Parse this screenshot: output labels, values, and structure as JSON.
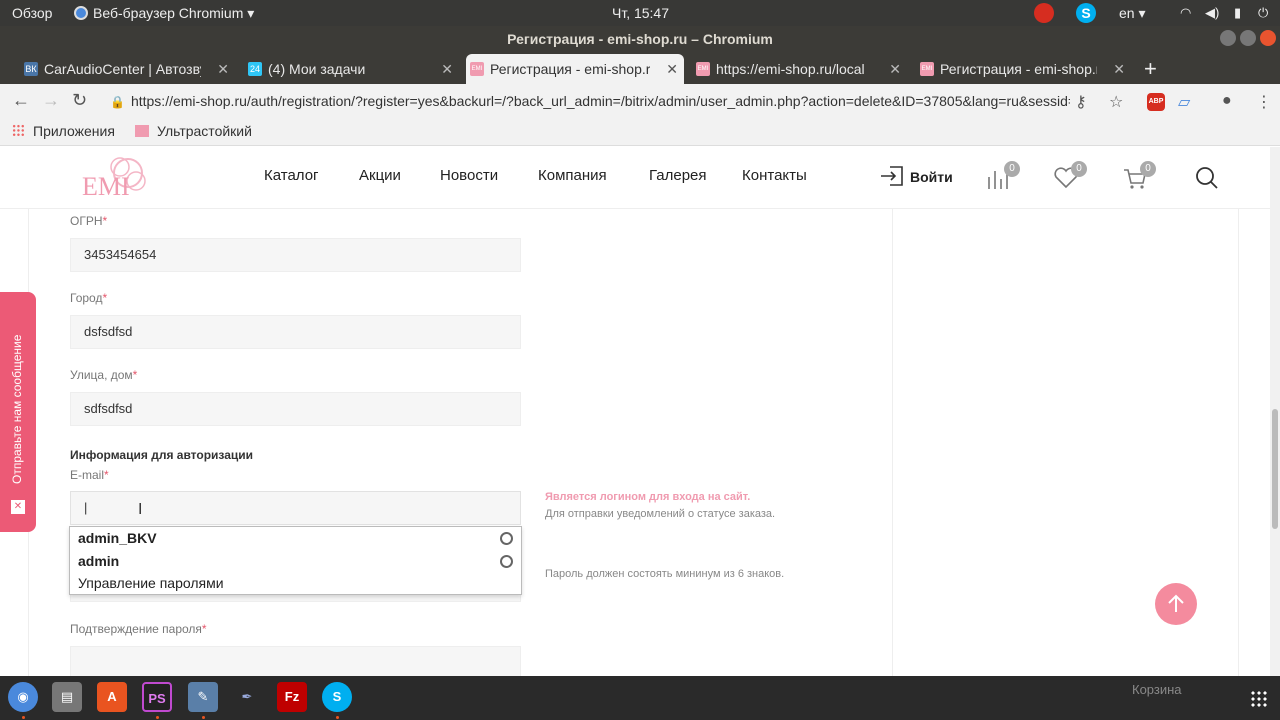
{
  "os": {
    "activities": "Обзор",
    "app_menu": "Веб-браузер Chromium",
    "clock": "Чт, 15:47",
    "lang": "en"
  },
  "window": {
    "title": "Регистрация - emi-shop.ru – Chromium"
  },
  "tabs": [
    {
      "label": "CarAudioCenter | Автозвук",
      "favicon": "ВК"
    },
    {
      "label": "(4) Мои задачи",
      "favicon": "24"
    },
    {
      "label": "Регистрация - emi-shop.ru",
      "favicon": "EMI"
    },
    {
      "label": "https://emi-shop.ru/local",
      "favicon": "EMI"
    },
    {
      "label": "Регистрация - emi-shop.ru",
      "favicon": "EMI"
    }
  ],
  "toolbar": {
    "url": "https://emi-shop.ru/auth/registration/?register=yes&backurl=/?back_url_admin=/bitrix/admin/user_admin.php?action=delete&ID=37805&lang=ru&sessid=...",
    "abp": "ABP"
  },
  "bookmarks": {
    "apps": "Приложения",
    "item1": "Ультрастойкий"
  },
  "site": {
    "logo": "EMI",
    "menu": [
      "Каталог",
      "Акции",
      "Новости",
      "Компания",
      "Галерея",
      "Контакты"
    ],
    "login": "Войти",
    "badges": {
      "compare": "0",
      "favorites": "0",
      "cart": "0"
    }
  },
  "form": {
    "ogrn_label": "ОГРН",
    "ogrn_value": "3453454654",
    "city_label": "Город",
    "city_value": "dsfsdfsd",
    "street_label": "Улица, дом",
    "street_value": "sdfsdfsd",
    "auth_section": "Информация для авторизации",
    "email_label": "E-mail",
    "email_value": "",
    "email_hint_pink": "Является логином для входа на сайт.",
    "email_hint": "Для отправки уведомлений о статусе заказа.",
    "password_hint": "Пароль должен состоять мининум из 6 знаков.",
    "confirm_label": "Подтверждение пароля",
    "required_mark": "*"
  },
  "autocomplete": {
    "items": [
      "admin_BKV",
      "admin"
    ],
    "manage": "Управление паролями"
  },
  "side_tab": {
    "label": "Отправьте нам сообщение"
  },
  "dock": {
    "cart_label": "Корзина"
  },
  "colors": {
    "accent": "#ec5a76",
    "scroll_top": "#f48b9e"
  }
}
